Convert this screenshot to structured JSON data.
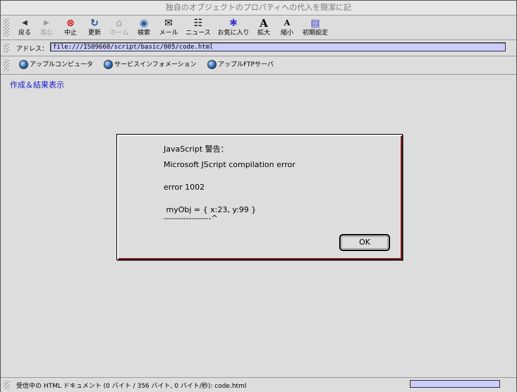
{
  "window": {
    "title": "独自のオブジェクトのプロパティへの代入を簡潔に記"
  },
  "toolbar": {
    "buttons": [
      {
        "label": "戻る",
        "icon": "back-arrow-icon",
        "glyph": "◆"
      },
      {
        "label": "進む",
        "icon": "forward-arrow-icon",
        "glyph": "◆"
      },
      {
        "label": "中止",
        "icon": "stop-icon",
        "glyph": "⊗"
      },
      {
        "label": "更新",
        "icon": "reload-icon",
        "glyph": "↻"
      },
      {
        "label": "ホーム",
        "icon": "home-icon",
        "glyph": "⌂"
      },
      {
        "label": "検索",
        "icon": "search-icon",
        "glyph": "◉"
      },
      {
        "label": "メール",
        "icon": "mail-icon",
        "glyph": "✉"
      },
      {
        "label": "ニュース",
        "icon": "news-icon",
        "glyph": "☷"
      },
      {
        "label": "お気に入り",
        "icon": "favorites-icon",
        "glyph": "✱"
      },
      {
        "label": "拡大",
        "icon": "enlarge-text-icon",
        "glyph": "A"
      },
      {
        "label": "縮小",
        "icon": "shrink-text-icon",
        "glyph": "A"
      },
      {
        "label": "初期設定",
        "icon": "preferences-icon",
        "glyph": "▤"
      }
    ]
  },
  "address": {
    "label": "アドレス：",
    "value": "file:///IS09660/script/basic/005/code.html"
  },
  "links": [
    {
      "label": "アップルコンピュータ"
    },
    {
      "label": "サービスインフォメーション"
    },
    {
      "label": "アップルFTPサーバ"
    }
  ],
  "page": {
    "link_text": "作成＆結果表示"
  },
  "alert": {
    "title": "JavaScript 警告：",
    "line1": "Microsoft JScript compilation error",
    "line2": "error 1002",
    "line3": " myObj = { x:23, y:99 }",
    "line4": "-----------------^",
    "ok_label": "OK"
  },
  "status": {
    "text": "受信中の HTML ドキュメント (0 バイト / 356 バイト, 0 バイト/秒): code.html"
  }
}
